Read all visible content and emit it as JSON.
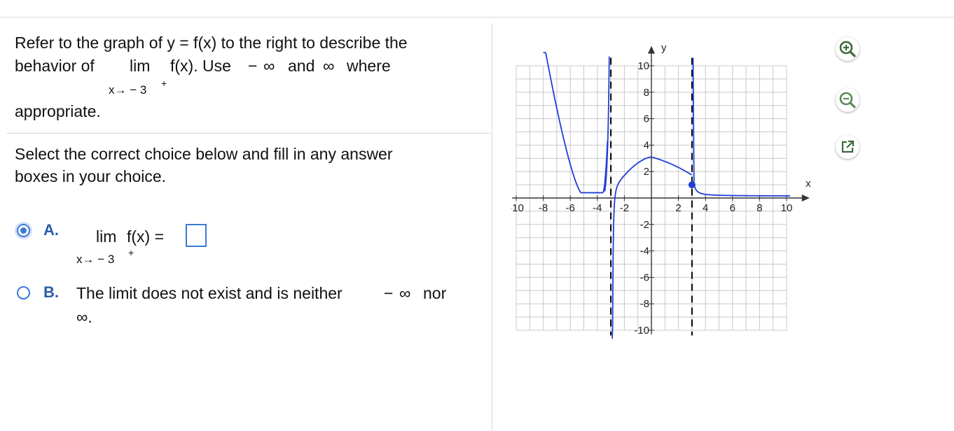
{
  "question": {
    "line1": "Refer to the graph of y = f(x) to the right to describe the",
    "line2_prefix": "behavior of",
    "lim": "lim",
    "line2_fx": "f(x). Use",
    "minus": "−",
    "inf": "∞",
    "and": "and",
    "where": "where",
    "sub": "x→ − 3",
    "sup": "+",
    "line3": "appropriate."
  },
  "instruction": {
    "line1": "Select the correct choice below and fill in any answer",
    "line2": "boxes in your choice."
  },
  "choices": {
    "a": {
      "letter": "A.",
      "selected": true,
      "lim": "lim",
      "expr": "f(x) =",
      "sub": "x→ − 3",
      "sup": "+",
      "answer": ""
    },
    "b": {
      "letter": "B.",
      "selected": false,
      "text1": "The limit does not exist and is neither",
      "minus": "−",
      "inf": "∞",
      "nor": "nor",
      "text2": "∞."
    }
  },
  "graph": {
    "x_axis_label": "x",
    "y_axis_label": "y",
    "x_ticks": [
      "-10",
      "-8",
      "-6",
      "-4",
      "-2",
      "2",
      "4",
      "6",
      "8",
      "10"
    ],
    "y_ticks": [
      "10",
      "8",
      "6",
      "4",
      "2",
      "-2",
      "-4",
      "-6",
      "-8",
      "-10"
    ],
    "asymptotes_x": [
      -3,
      3
    ],
    "closed_point": [
      3,
      1
    ],
    "curve_color": "#1f3fd8",
    "grid_color": "#c8c8c8"
  },
  "tools": {
    "zoom_in": "zoom-in-icon",
    "zoom_out": "zoom-out-icon",
    "popout": "popout-icon"
  }
}
